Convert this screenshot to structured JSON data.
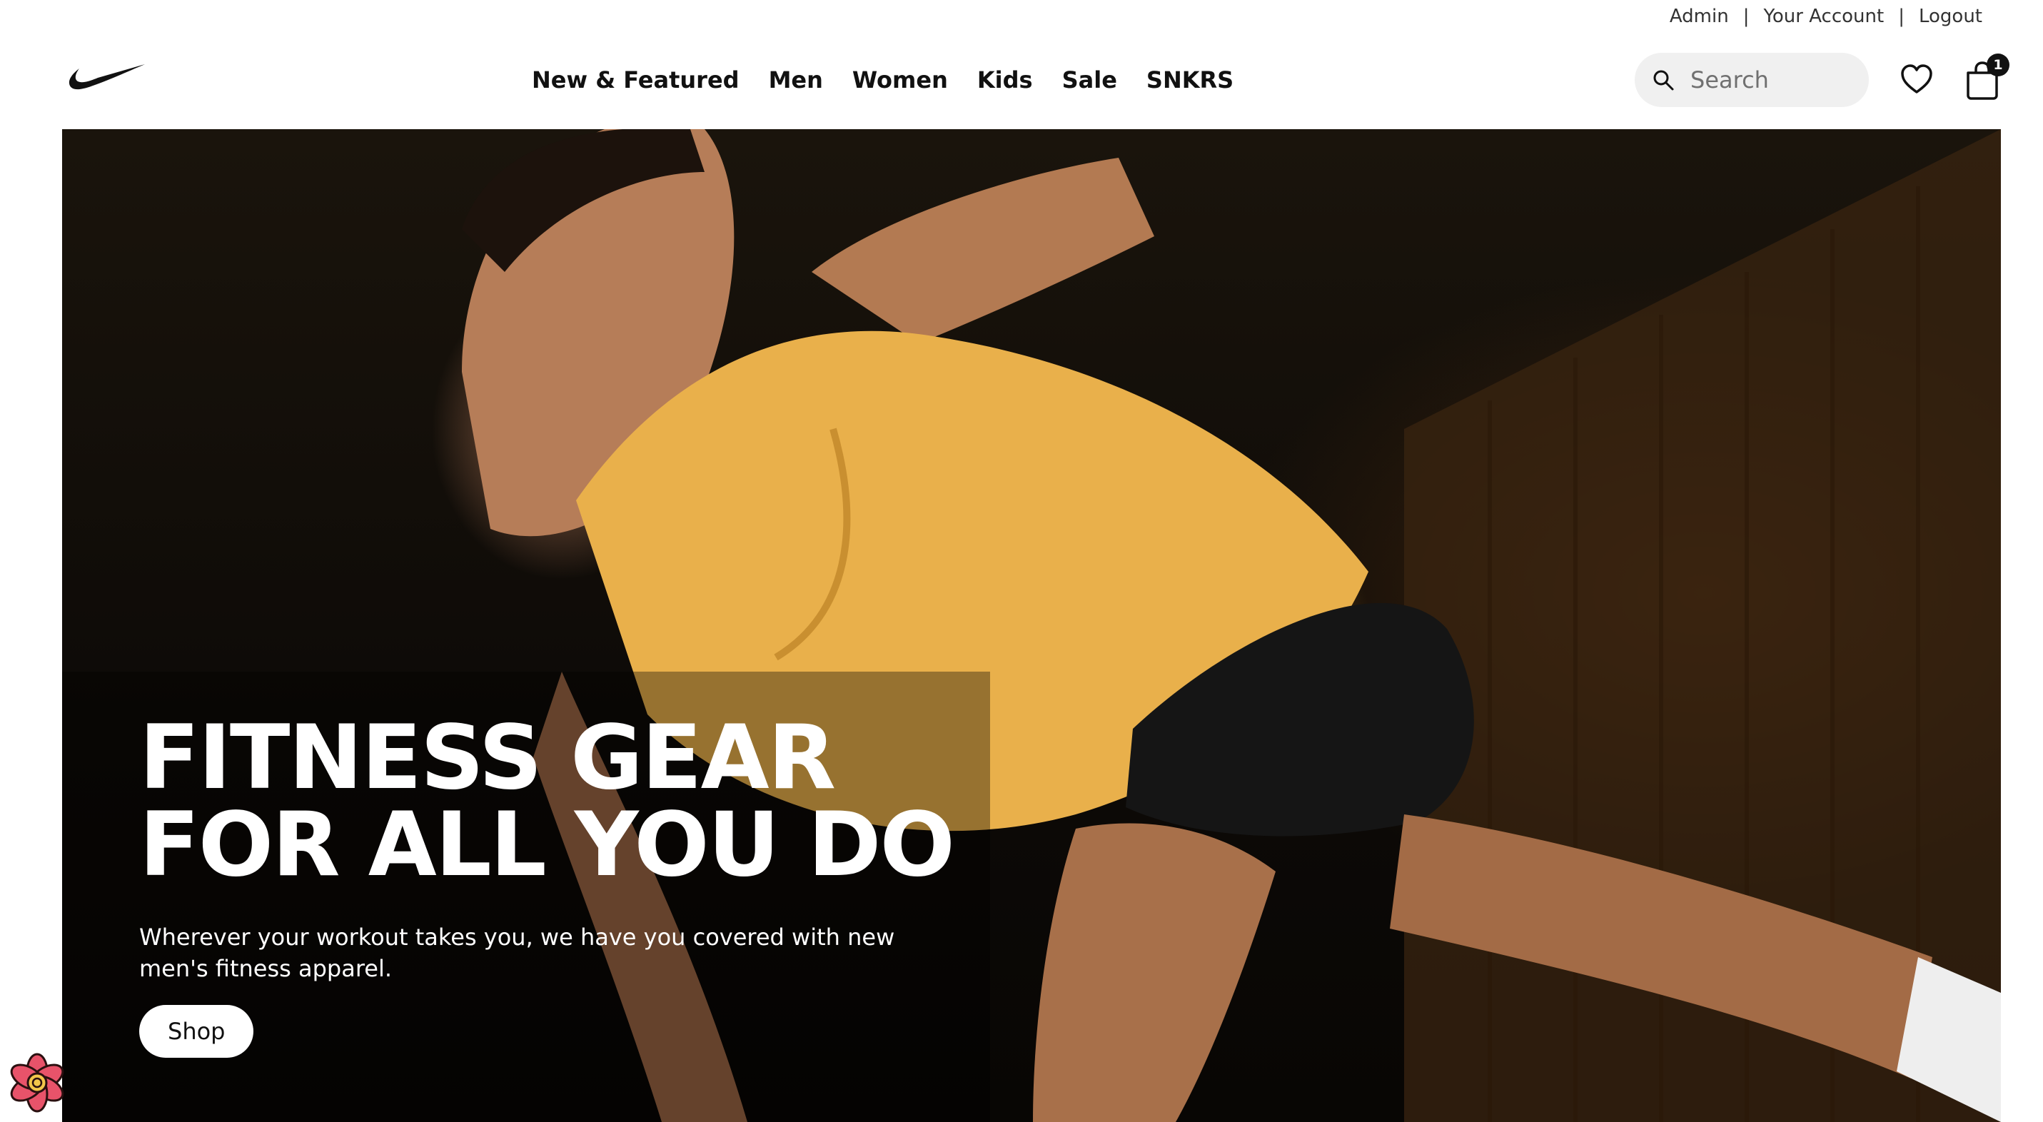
{
  "utility": {
    "links": [
      "Admin",
      "Your Account",
      "Logout"
    ],
    "separator": "|"
  },
  "header": {
    "logo_icon": "swoosh-logo-icon",
    "nav": [
      "New & Featured",
      "Men",
      "Women",
      "Kids",
      "Sale",
      "SNKRS"
    ],
    "search": {
      "placeholder": "Search",
      "value": "",
      "icon": "search-icon"
    },
    "favorites_icon": "heart-icon",
    "bag_icon": "shopping-bag-icon",
    "bag_count": "1"
  },
  "hero": {
    "title": "FITNESS GEAR\nFOR ALL YOU DO",
    "subtitle": "Wherever your workout takes you, we have you covered with new men's fitness apparel.",
    "cta": "Shop"
  },
  "dev_badge_icon": "flower-badge-icon",
  "colors": {
    "text": "#111111",
    "search_bg": "#f0f0f0",
    "hero_shirt": "#e9b04b",
    "badge": "#111111"
  }
}
